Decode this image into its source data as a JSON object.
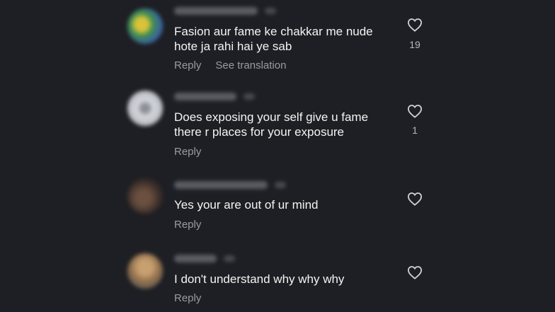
{
  "comments": [
    {
      "text": "Fasion aur fame ke chakkar me nude\nhote ja rahi hai ye sab",
      "reply_label": "Reply",
      "translate_label": "See translation",
      "likes": "19",
      "avatar_color": "#4a8a5a"
    },
    {
      "text": "Does exposing your self give u fame\nthere r places  for your  exposure",
      "reply_label": "Reply",
      "likes": "1",
      "avatar_color": "#c9cdd3"
    },
    {
      "text": "Yes your are out of ur mind",
      "reply_label": "Reply",
      "avatar_color": "#4b3a30"
    },
    {
      "text": "I don't understand why why why",
      "reply_label": "Reply",
      "avatar_color": "#a0845c"
    }
  ],
  "icons": {
    "like": "heart-outline-icon"
  },
  "colors": {
    "background": "#1e1f24",
    "text": "#f4f4f4",
    "secondary_text": "#9a9ca2"
  }
}
